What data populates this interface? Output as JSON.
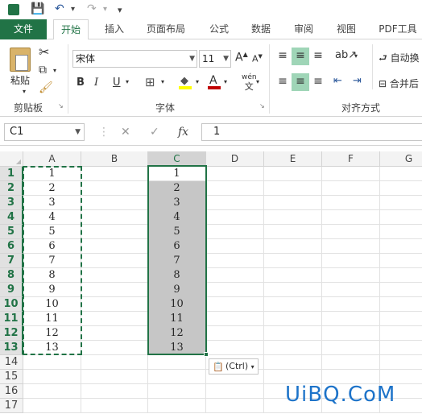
{
  "quick_access": {
    "save": "💾",
    "undo": "↶",
    "redo": "↷",
    "customize": "▾"
  },
  "tabs": [
    {
      "label": "文件"
    },
    {
      "label": "开始"
    },
    {
      "label": "插入"
    },
    {
      "label": "页面布局"
    },
    {
      "label": "公式"
    },
    {
      "label": "数据"
    },
    {
      "label": "审阅"
    },
    {
      "label": "视图"
    },
    {
      "label": "PDF工具"
    }
  ],
  "ribbon": {
    "clipboard": {
      "paste_label": "粘贴",
      "group_label": "剪贴板"
    },
    "font": {
      "font_name": "宋体",
      "font_size": "11",
      "bold": "B",
      "italic": "I",
      "underline": "U",
      "grow": "A",
      "shrink": "A",
      "wen": "wén",
      "group_label": "字体"
    },
    "alignment": {
      "wrap": "自动换",
      "merge": "合并后",
      "group_label": "对齐方式"
    }
  },
  "formula_bar": {
    "name_box": "C1",
    "fx": "fx",
    "value": "1"
  },
  "columns": [
    "A",
    "B",
    "C",
    "D",
    "E",
    "F",
    "G"
  ],
  "rows": [
    "1",
    "2",
    "3",
    "4",
    "5",
    "6",
    "7",
    "8",
    "9",
    "10",
    "11",
    "12",
    "13",
    "14",
    "15",
    "16",
    "17"
  ],
  "col_a_values": [
    "1",
    "2",
    "3",
    "4",
    "5",
    "6",
    "7",
    "8",
    "9",
    "10",
    "11",
    "12",
    "13"
  ],
  "col_c_values": [
    "1",
    "2",
    "3",
    "4",
    "5",
    "6",
    "7",
    "8",
    "9",
    "10",
    "11",
    "12",
    "13"
  ],
  "paste_options": {
    "label": "(Ctrl)"
  },
  "watermark": "UiBQ.CoM",
  "colors": {
    "accent": "#217346",
    "selection_shade": "#c6c6c6"
  }
}
